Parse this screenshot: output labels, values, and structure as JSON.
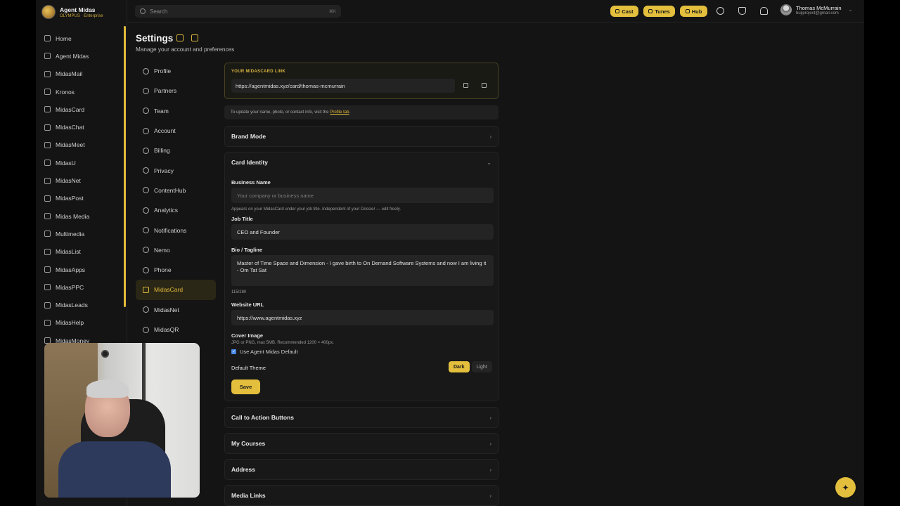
{
  "brand": {
    "name": "Agent Midas",
    "subtitle": "OLYMPUS · Enterprise"
  },
  "app_nav": [
    {
      "label": "Home",
      "icon": "home-icon"
    },
    {
      "label": "Agent Midas",
      "icon": "chat-icon"
    },
    {
      "label": "MidasMail",
      "icon": "mail-icon"
    },
    {
      "label": "Kronos",
      "icon": "clock-icon"
    },
    {
      "label": "MidasCard",
      "icon": "card-icon"
    },
    {
      "label": "MidasChat",
      "icon": "chat-bubble-icon"
    },
    {
      "label": "MidasMeet",
      "icon": "video-icon"
    },
    {
      "label": "MidasU",
      "icon": "graduation-icon"
    },
    {
      "label": "MidasNet",
      "icon": "globe-icon"
    },
    {
      "label": "MidasPost",
      "icon": "share-icon"
    },
    {
      "label": "Midas Media",
      "icon": "media-icon"
    },
    {
      "label": "Multimedia",
      "icon": "film-icon"
    },
    {
      "label": "MidasList",
      "icon": "list-icon"
    },
    {
      "label": "MidasApps",
      "icon": "apps-icon"
    },
    {
      "label": "MidasPPC",
      "icon": "megaphone-icon"
    },
    {
      "label": "MidasLeads",
      "icon": "target-icon"
    },
    {
      "label": "MidasHelp",
      "icon": "help-icon"
    },
    {
      "label": "MidasMoney",
      "icon": "dollar-icon"
    }
  ],
  "topbar": {
    "search_placeholder": "Search",
    "search_shortcut": "⌘K",
    "pills": [
      {
        "label": "Cast",
        "icon": "cast-icon"
      },
      {
        "label": "Tunes",
        "icon": "music-icon"
      },
      {
        "label": "Hub",
        "icon": "users-icon"
      }
    ],
    "icons": [
      "check-circle-icon",
      "trophy-icon",
      "bell-icon"
    ],
    "user": {
      "name": "Thomas McMurrain",
      "email": "bujiproject@gmail.com"
    }
  },
  "page": {
    "title": "Settings",
    "subtitle": "Manage your account and preferences"
  },
  "settings_nav": [
    {
      "label": "Profile",
      "icon": "user-icon"
    },
    {
      "label": "Partners",
      "icon": "briefcase-icon"
    },
    {
      "label": "Team",
      "icon": "team-icon"
    },
    {
      "label": "Account",
      "icon": "account-icon"
    },
    {
      "label": "Billing",
      "icon": "credit-card-icon"
    },
    {
      "label": "Privacy",
      "icon": "eye-icon"
    },
    {
      "label": "ContentHub",
      "icon": "folder-icon"
    },
    {
      "label": "Analytics",
      "icon": "chart-icon"
    },
    {
      "label": "Notifications",
      "icon": "bell-icon"
    },
    {
      "label": "Nemo",
      "icon": "broadcast-icon"
    },
    {
      "label": "Phone",
      "icon": "phone-icon"
    },
    {
      "label": "MidasCard",
      "icon": "card-icon",
      "active": true
    },
    {
      "label": "MidasNet",
      "icon": "globe-icon"
    },
    {
      "label": "MidasQR",
      "icon": "qr-icon"
    }
  ],
  "midascard_link": {
    "label": "YOUR MIDASCARD LINK",
    "url": "https://agentmidas.xyz/card/thomas-mcmurrain"
  },
  "hint": {
    "text": "To update your name, photo, or contact info, visit the",
    "link": "Profile tab",
    "end": "."
  },
  "sections": {
    "brand_mode": "Brand Mode",
    "card_identity": "Card Identity",
    "cta": "Call to Action Buttons",
    "courses": "My Courses",
    "address": "Address",
    "media_links": "Media Links"
  },
  "card_identity": {
    "business_name_label": "Business Name",
    "business_name_placeholder": "Your company or business name",
    "business_name_note": "Appears on your MidasCard under your job title. Independent of your Dossier — edit freely.",
    "job_title_label": "Job Title",
    "job_title_value": "CEO and Founder",
    "bio_label": "Bio / Tagline",
    "bio_value": "Master of Time Space and Dimension - I gave birth to On Demand Software Systems and now I am living it - Om Tat Sat",
    "bio_count": "115/280",
    "website_label": "Website URL",
    "website_value": "https://www.agentmidas.xyz",
    "cover_label": "Cover Image",
    "cover_note": "JPG or PNG, max 5MB. Recommended 1200 × 400px.",
    "use_default_label": "Use Agent Midas Default",
    "use_default_checked": true,
    "theme_label": "Default Theme",
    "theme_dark": "Dark",
    "theme_light": "Light",
    "theme_selected": "Dark",
    "save_label": "Save"
  },
  "colors": {
    "accent": "#e3bf3d",
    "background": "#141414",
    "panel": "#181818"
  }
}
